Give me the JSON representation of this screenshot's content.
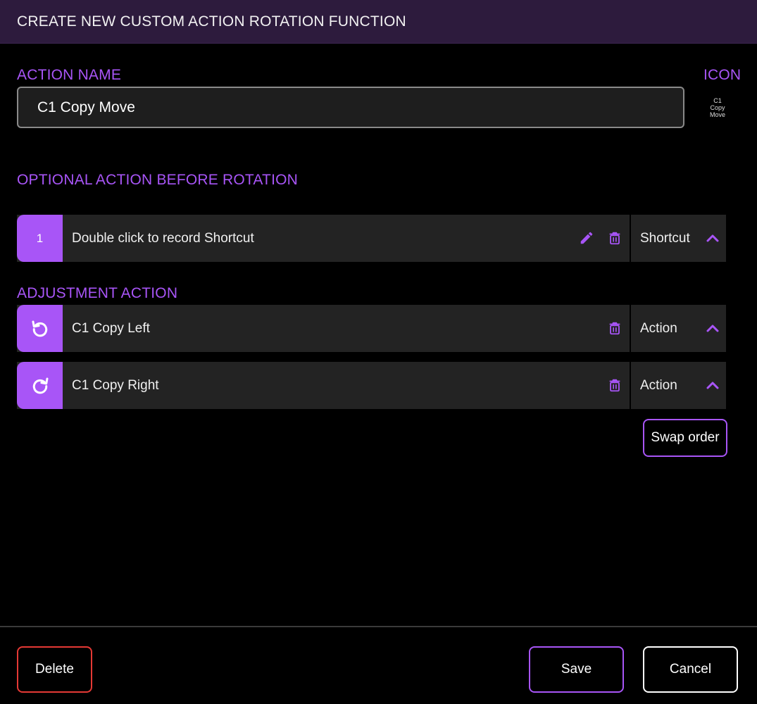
{
  "header": {
    "title": "CREATE NEW CUSTOM ACTION ROTATION FUNCTION"
  },
  "action_name": {
    "label": "ACTION NAME",
    "value": "C1 Copy Move"
  },
  "icon": {
    "label": "ICON",
    "lines": [
      "C1",
      "Copy",
      "Move"
    ]
  },
  "optional_before": {
    "label": "OPTIONAL ACTION BEFORE ROTATION",
    "items": [
      {
        "badge": "1",
        "text": "Double click to record Shortcut",
        "type": "Shortcut"
      }
    ]
  },
  "adjustment": {
    "label": "ADJUSTMENT ACTION",
    "items": [
      {
        "icon": "rotate-left-icon",
        "text": "C1 Copy Left",
        "type": "Action"
      },
      {
        "icon": "rotate-right-icon",
        "text": "C1 Copy Right",
        "type": "Action"
      }
    ],
    "swap_label": "Swap order"
  },
  "footer": {
    "delete_label": "Delete",
    "save_label": "Save",
    "cancel_label": "Cancel"
  },
  "colors": {
    "accent": "#a855f7",
    "danger": "#e53935",
    "header_bg": "#2d1b3d"
  }
}
